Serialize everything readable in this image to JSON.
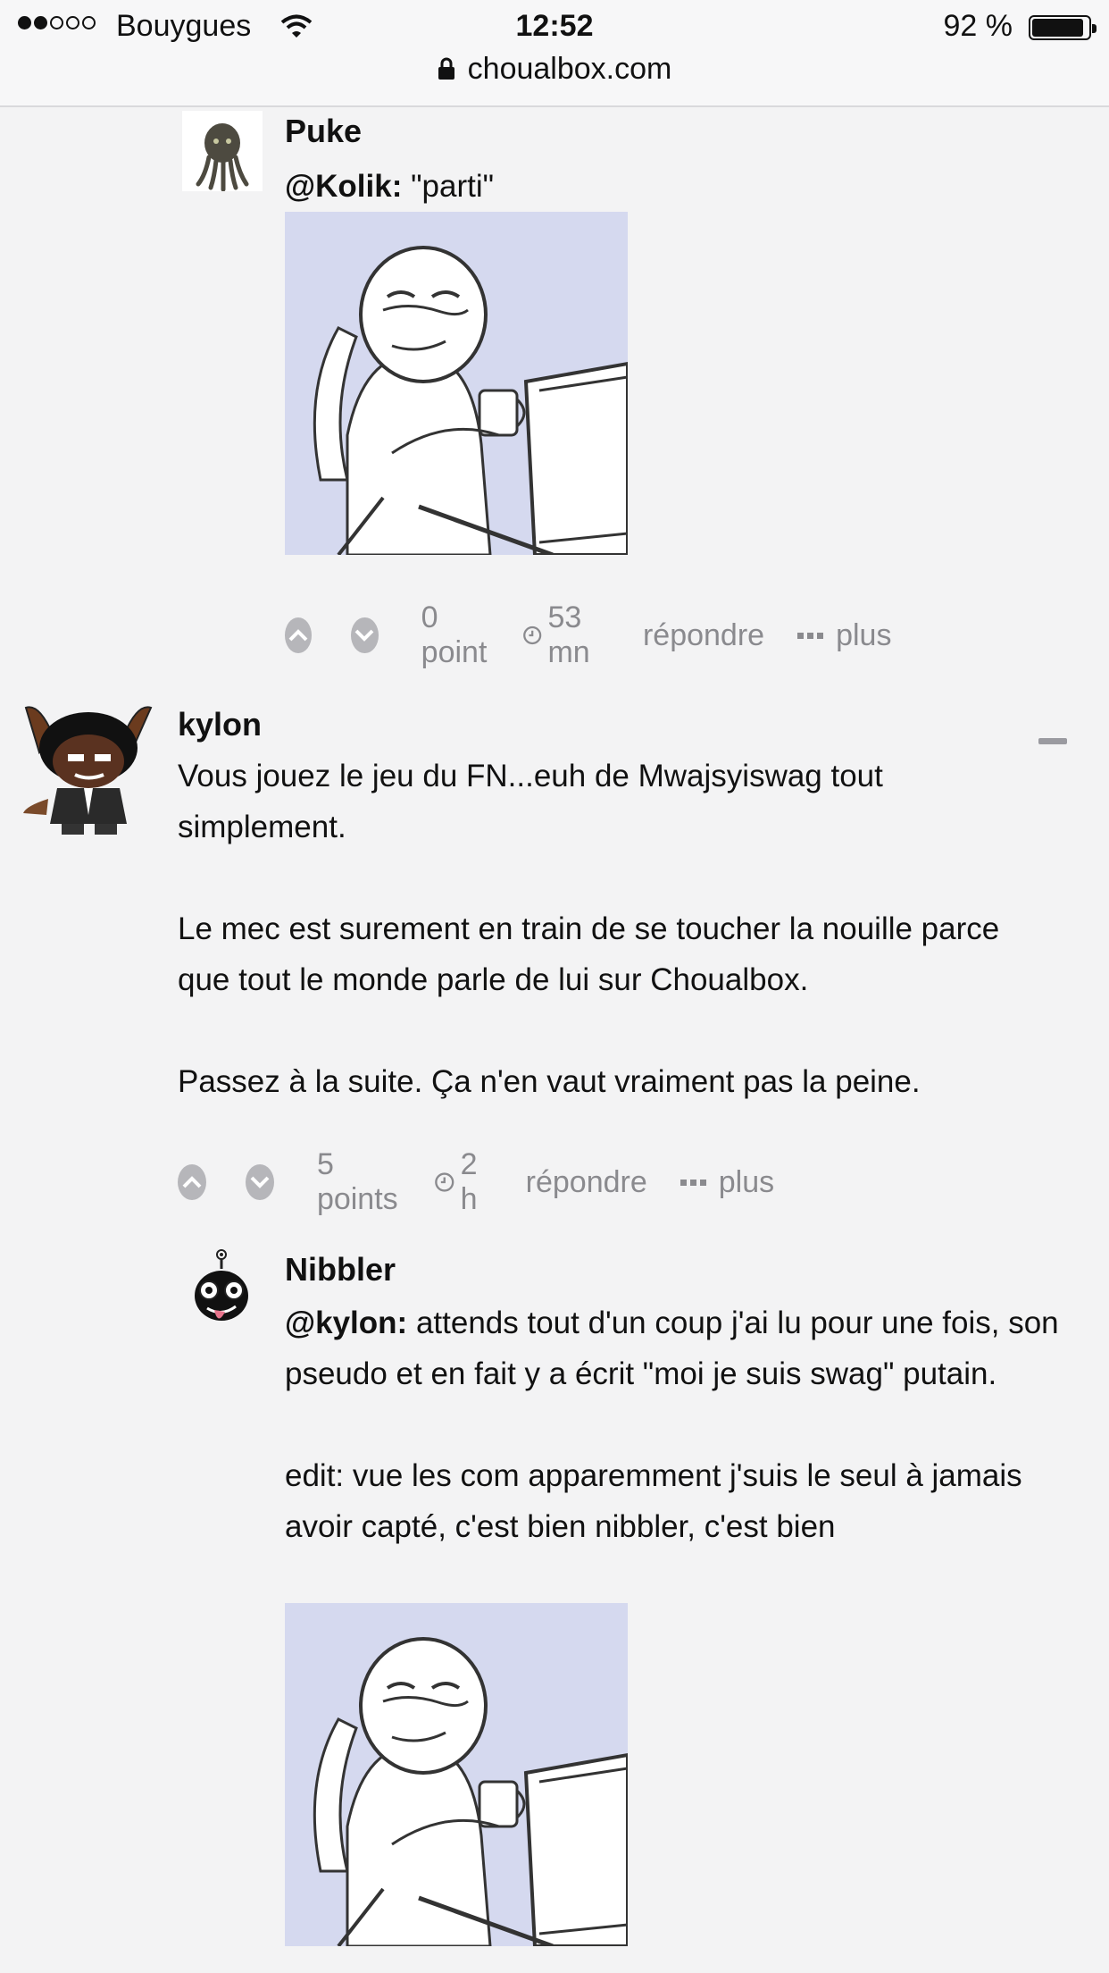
{
  "status_bar": {
    "carrier": "Bouygues",
    "time": "12:52",
    "battery": "92 %"
  },
  "url_bar": {
    "domain": "choualbox.com"
  },
  "comments": [
    {
      "username": "Puke",
      "mention": "@Kolik:",
      "text": "\"parti\"",
      "points": "0 point",
      "age": "53 mn",
      "reply_label": "répondre",
      "more_label": "plus"
    },
    {
      "username": "kylon",
      "paragraphs": [
        "Vous jouez le jeu du FN...euh de Mwajsyiswag tout simplement.",
        "Le mec est surement en train de se toucher la nouille parce que tout le monde parle de lui sur Choualbox.",
        "Passez à la suite. Ça n'en vaut vraiment pas la peine."
      ],
      "points": "5 points",
      "age": "2 h",
      "reply_label": "répondre",
      "more_label": "plus"
    },
    {
      "username": "Nibbler",
      "mention": "@kylon:",
      "text": "attends tout d'un coup j'ai lu pour une fois, son pseudo et en fait y a écrit \"moi je suis swag\" putain.",
      "edit_text": "edit: vue les com apparemment j'suis le seul à jamais avoir capté, c'est bien nibbler, c'est bien"
    }
  ],
  "icons": [
    "lock-icon",
    "wifi-icon",
    "upvote-icon",
    "downvote-icon",
    "clock-icon",
    "more-dots-icon",
    "collapse-icon"
  ]
}
